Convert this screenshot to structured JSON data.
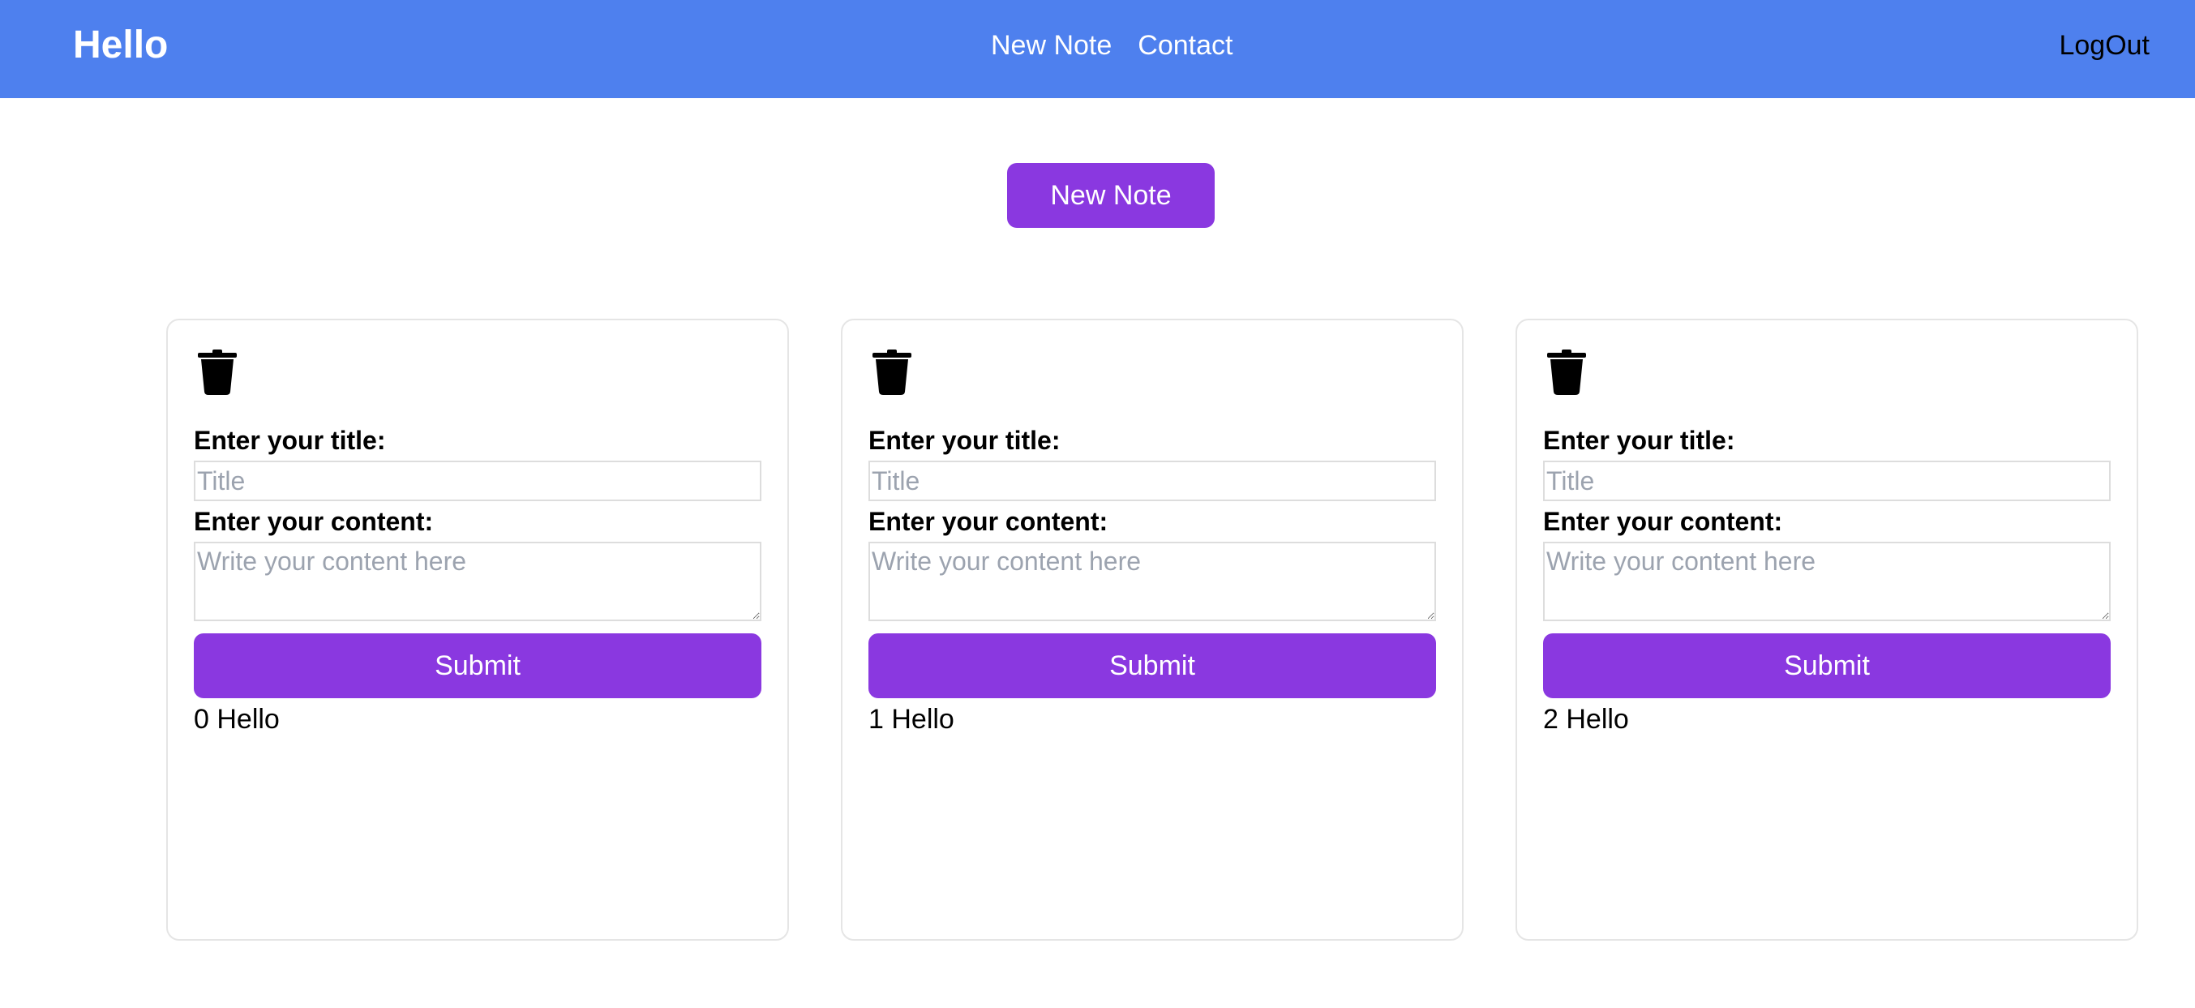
{
  "nav": {
    "brand": "Hello",
    "links": [
      "New Note",
      "Contact"
    ],
    "logout": "LogOut"
  },
  "actions": {
    "new_note_label": "New Note"
  },
  "colors": {
    "navbar": "#4e80ee",
    "accent": "#8a38e0"
  },
  "notes": [
    {
      "delete_icon": "trash-icon",
      "title_label": "Enter your title:",
      "title_placeholder": "Title",
      "title_value": "",
      "content_label": "Enter your content:",
      "content_placeholder": "Write your content here",
      "content_value": "",
      "submit_label": "Submit",
      "text": "0 Hello"
    },
    {
      "delete_icon": "trash-icon",
      "title_label": "Enter your title:",
      "title_placeholder": "Title",
      "title_value": "",
      "content_label": "Enter your content:",
      "content_placeholder": "Write your content here",
      "content_value": "",
      "submit_label": "Submit",
      "text": "1 Hello"
    },
    {
      "delete_icon": "trash-icon",
      "title_label": "Enter your title:",
      "title_placeholder": "Title",
      "title_value": "",
      "content_label": "Enter your content:",
      "content_placeholder": "Write your content here",
      "content_value": "",
      "submit_label": "Submit",
      "text": "2 Hello"
    }
  ]
}
